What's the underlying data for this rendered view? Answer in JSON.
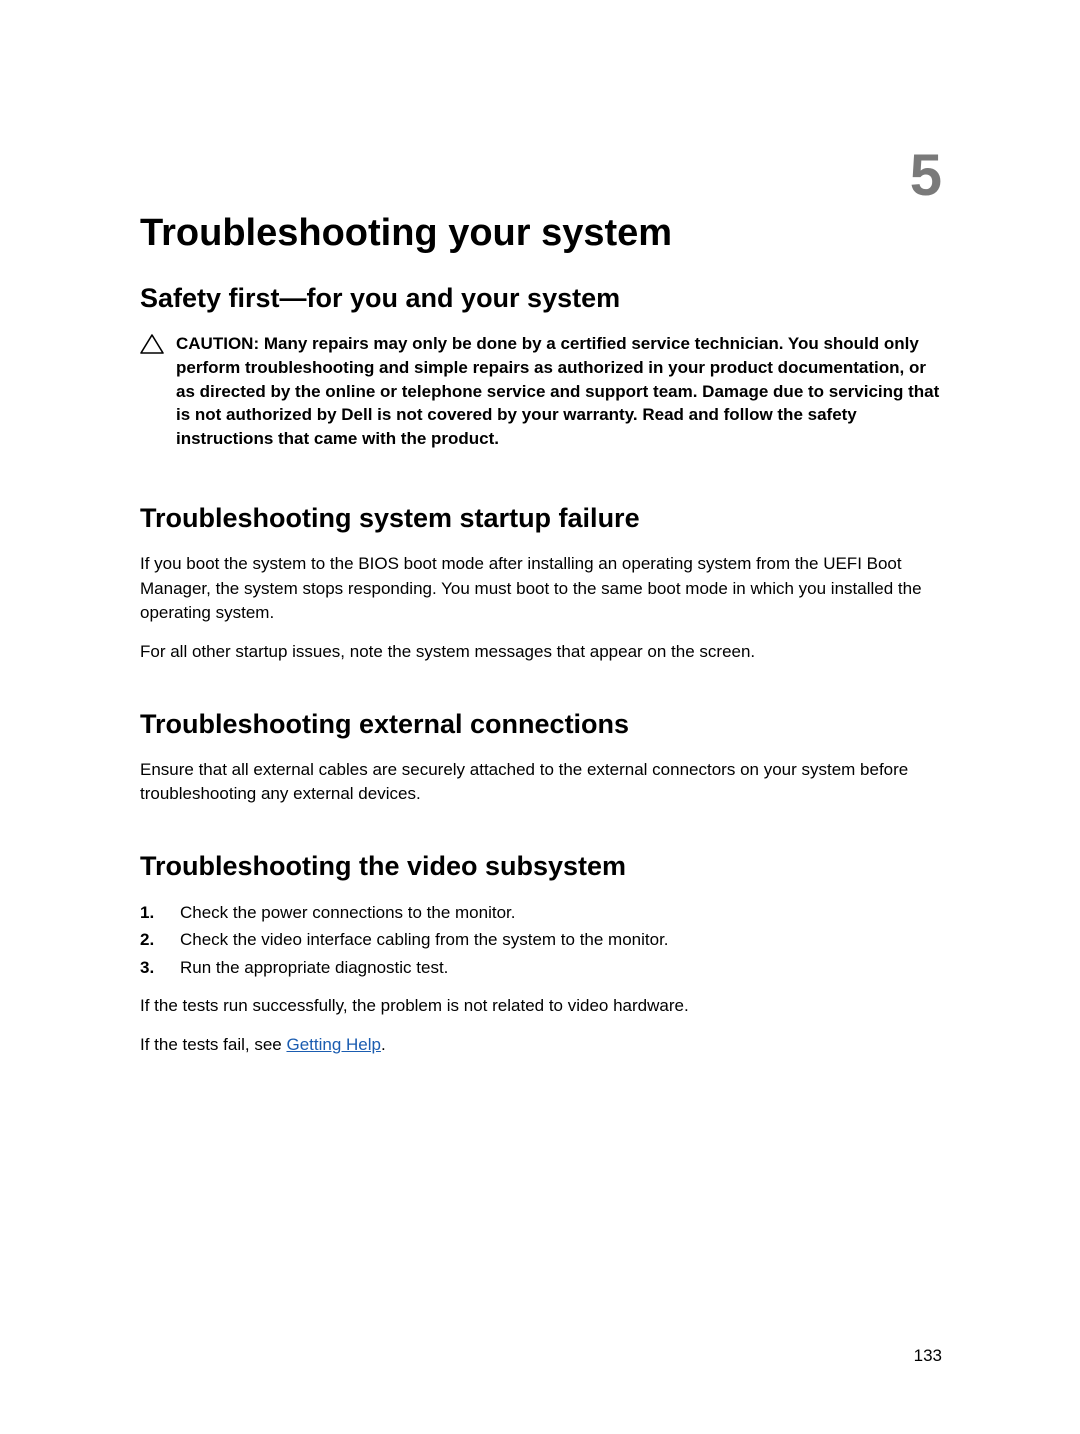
{
  "chapterNumber": "5",
  "pageTitle": "Troubleshooting your system",
  "sections": {
    "safety": {
      "heading": "Safety first—for you and your system",
      "cautionText": "CAUTION: Many repairs may only be done by a certified service technician. You should only perform troubleshooting and simple repairs as authorized in your product documentation, or as directed by the online or telephone service and support team. Damage due to servicing that is not authorized by Dell is not covered by your warranty. Read and follow the safety instructions that came with the product."
    },
    "startup": {
      "heading": "Troubleshooting system startup failure",
      "para1": "If you boot the system to the BIOS boot mode after installing an operating system from the UEFI Boot Manager, the system stops responding. You must boot to the same boot mode in which you installed the operating system.",
      "para2": "For all other startup issues, note the system messages that appear on the screen."
    },
    "external": {
      "heading": "Troubleshooting external connections",
      "para1": "Ensure that all external cables are securely attached to the external connectors on your system before troubleshooting any external devices."
    },
    "video": {
      "heading": "Troubleshooting the video subsystem",
      "steps": {
        "s1": "Check the power connections to the monitor.",
        "s2": "Check the video interface cabling from the system to the monitor.",
        "s3": "Run the appropriate diagnostic test."
      },
      "para1": "If the tests run successfully, the problem is not related to video hardware.",
      "para2_prefix": "If the tests fail, see ",
      "para2_link": "Getting Help",
      "para2_suffix": "."
    }
  },
  "pageNumber": "133"
}
